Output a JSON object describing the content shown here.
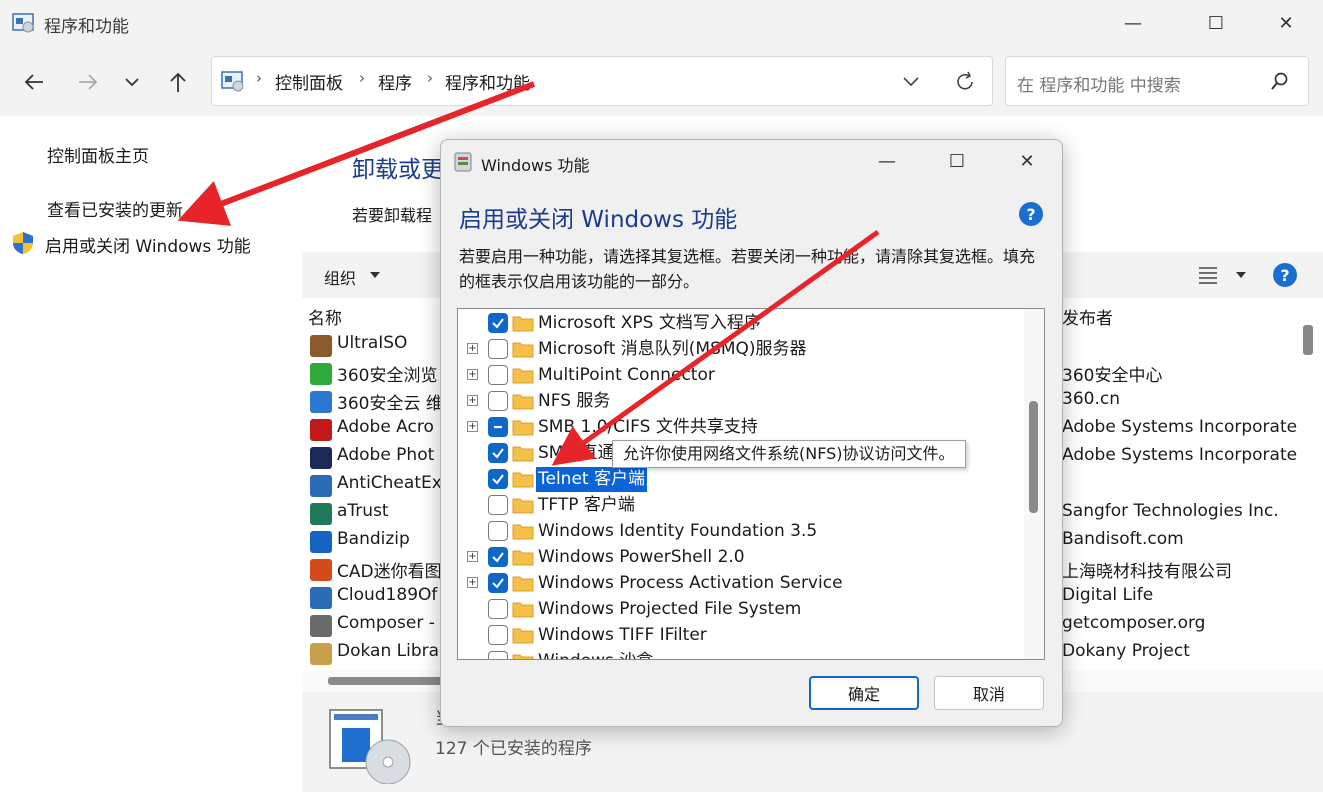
{
  "window": {
    "title": "程序和功能",
    "minimize_glyph": "—",
    "maximize_glyph": "☐",
    "close_glyph": "✕"
  },
  "address": {
    "crumbs": [
      "控制面板",
      "程序",
      "程序和功能"
    ],
    "separator": "›"
  },
  "search": {
    "placeholder": "在 程序和功能 中搜索"
  },
  "sidebar": {
    "home": "控制面板主页",
    "updates": "查看已安装的更新",
    "features": "启用或关闭 Windows 功能"
  },
  "content": {
    "title": "卸载或更",
    "description": "若要卸载程",
    "organize": "组织",
    "col_name": "名称",
    "col_publisher": "发布者"
  },
  "programs": [
    {
      "name": "UltraISO",
      "publisher": "",
      "color": "#8a5a2b"
    },
    {
      "name": "360安全浏览",
      "publisher": "360安全中心",
      "color": "#2fa83c"
    },
    {
      "name": "360安全云 维",
      "publisher": "360.cn",
      "color": "#2b78d0"
    },
    {
      "name": "Adobe Acro",
      "publisher": "Adobe Systems Incorporate",
      "color": "#c21a1a"
    },
    {
      "name": "Adobe Phot",
      "publisher": "Adobe Systems Incorporate",
      "color": "#1c2a5a"
    },
    {
      "name": "AntiCheatEx",
      "publisher": "",
      "color": "#2b6cb8"
    },
    {
      "name": "aTrust",
      "publisher": "Sangfor Technologies Inc.",
      "color": "#1e7a5a"
    },
    {
      "name": "Bandizip",
      "publisher": "Bandisoft.com",
      "color": "#1565c0"
    },
    {
      "name": "CAD迷你看图",
      "publisher": "上海晓材科技有限公司",
      "color": "#d44a1a"
    },
    {
      "name": "Cloud189Of",
      "publisher": "Digital Life",
      "color": "#2b6cb8"
    },
    {
      "name": "Composer -",
      "publisher": "getcomposer.org",
      "color": "#6a6a6a"
    },
    {
      "name": "Dokan Libra",
      "publisher": "Dokany Project",
      "color": "#c9a04a"
    }
  ],
  "status": {
    "count_text": "127 个已安装的程序",
    "label_partial": "当"
  },
  "dialog": {
    "title": "Windows 功能",
    "heading": "启用或关闭 Windows 功能",
    "description": "若要启用一种功能，请选择其复选框。若要关闭一种功能，请清除其复选框。填充的框表示仅启用该功能的一部分。",
    "help_glyph": "?",
    "ok": "确定",
    "cancel": "取消",
    "tooltip": "允许你使用网络文件系统(NFS)协议访问文件。",
    "features": [
      {
        "label": "Microsoft XPS 文档写入程序",
        "state": "checked",
        "expandable": false,
        "selected": false
      },
      {
        "label": "Microsoft 消息队列(MSMQ)服务器",
        "state": "unchecked",
        "expandable": true,
        "selected": false
      },
      {
        "label": "MultiPoint Connector",
        "state": "unchecked",
        "expandable": true,
        "selected": false
      },
      {
        "label": "NFS 服务",
        "state": "unchecked",
        "expandable": true,
        "selected": false
      },
      {
        "label": "SMB 1.0/CIFS 文件共享支持",
        "state": "partial",
        "expandable": true,
        "selected": false
      },
      {
        "label": "SMB 直通",
        "state": "checked",
        "expandable": false,
        "selected": false
      },
      {
        "label": "Telnet 客户端",
        "state": "checked",
        "expandable": false,
        "selected": true
      },
      {
        "label": "TFTP 客户端",
        "state": "unchecked",
        "expandable": false,
        "selected": false
      },
      {
        "label": "Windows Identity Foundation 3.5",
        "state": "unchecked",
        "expandable": false,
        "selected": false
      },
      {
        "label": "Windows PowerShell 2.0",
        "state": "checked",
        "expandable": true,
        "selected": false
      },
      {
        "label": "Windows Process Activation Service",
        "state": "checked",
        "expandable": true,
        "selected": false
      },
      {
        "label": "Windows Projected File System",
        "state": "unchecked",
        "expandable": false,
        "selected": false
      },
      {
        "label": "Windows TIFF IFilter",
        "state": "unchecked",
        "expandable": false,
        "selected": false
      },
      {
        "label": "Windows 沙盒",
        "state": "unchecked",
        "expandable": false,
        "selected": false
      }
    ]
  },
  "colors": {
    "accent": "#0f67c7",
    "heading": "#1a3c8c",
    "selection": "#0a64d8",
    "annotation_arrow": "#e8242b",
    "folder": "#f4c04a"
  }
}
